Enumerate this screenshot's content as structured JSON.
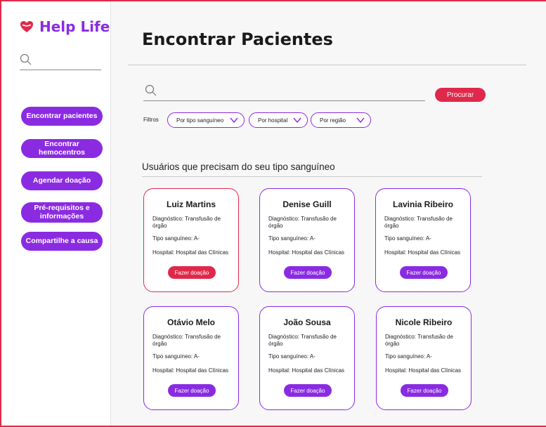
{
  "app": {
    "name": "Help Life",
    "brand_color": "#8a2be2",
    "accent_color": "#e0294a"
  },
  "sidebar": {
    "search_placeholder": "",
    "nav": [
      {
        "label": "Encontrar pacientes"
      },
      {
        "label": "Encontrar hemocentros"
      },
      {
        "label": "Agendar doação"
      },
      {
        "label": "Pré-requisitos e informações"
      },
      {
        "label": "Compartilhe a causa"
      }
    ]
  },
  "main": {
    "title": "Encontrar Pacientes",
    "search": {
      "placeholder": "",
      "button_label": "Procurar"
    },
    "filters": {
      "label": "Filtros",
      "items": [
        {
          "label": "Por tipo sanguíneo"
        },
        {
          "label": "Por hospital"
        },
        {
          "label": "Por região"
        }
      ]
    },
    "section_title": "Usuários que precisam do seu tipo sanguíneo",
    "cards": [
      {
        "name": "Luiz Martins",
        "diagnosis": "Diagnóstico: Transfusão de órgão",
        "blood_type": "Tipo sanguíneo: A-",
        "hospital": "Hospital: Hospital das Clínicas",
        "button": "Fazer doação"
      },
      {
        "name": "Denise Guill",
        "diagnosis": "Diagnóstico: Transfusão de órgão",
        "blood_type": "Tipo sanguíneo: A-",
        "hospital": "Hospital: Hospital das Clínicas",
        "button": "Fazer doação"
      },
      {
        "name": "Lavinia Ribeiro",
        "diagnosis": "Diagnóstico: Transfusão de órgão",
        "blood_type": "Tipo sanguíneo: A-",
        "hospital": "Hospital: Hospital das Clínicas",
        "button": "Fazer doação"
      },
      {
        "name": "Otávio Melo",
        "diagnosis": "Diagnóstico: Transfusão de órgão",
        "blood_type": "Tipo sanguíneo: A-",
        "hospital": "Hospital: Hospital das Clínicas",
        "button": "Fazer doação"
      },
      {
        "name": "João Sousa",
        "diagnosis": "Diagnóstico: Transfusão de órgão",
        "blood_type": "Tipo sanguíneo: A-",
        "hospital": "Hospital: Hospital das Clínicas",
        "button": "Fazer doação"
      },
      {
        "name": "Nicole Ribeiro",
        "diagnosis": "Diagnóstico: Transfusão de órgão",
        "blood_type": "Tipo sanguíneo: A-",
        "hospital": "Hospital: Hospital das Clínicas",
        "button": "Fazer doação"
      }
    ]
  }
}
